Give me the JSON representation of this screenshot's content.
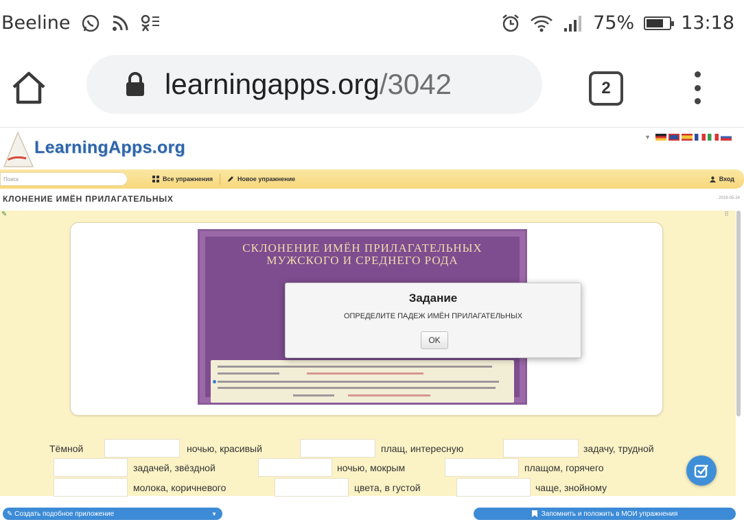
{
  "status_bar": {
    "carrier": "Beeline",
    "battery_percent_text": "75%",
    "battery_level": 0.75,
    "time": "13:18"
  },
  "browser": {
    "url_host": "learningapps.org",
    "url_path": "/3042",
    "tab_count": "2"
  },
  "site": {
    "logo": "LearningApps.org",
    "search_placeholder": "Поиск",
    "nav_all": "Все упражнения",
    "nav_new": "Новое упражнение",
    "nav_login": "Вход",
    "exercise_title": "КЛОНЕНИЕ ИМЁН ПРИЛАГАТЕЛЬНЫХ",
    "exercise_date": "2019-05-24"
  },
  "poster": {
    "title_line1": "СКЛОНЕНИЕ ИМЁН ПРИЛАГАТЕЛЬНЫХ",
    "title_line2": "МУЖСКОГО И СРЕДНЕГО РОДА"
  },
  "dialog": {
    "title": "Задание",
    "text": "ОПРЕДЕЛИТЕ ПАДЕЖ ИМЁН ПРИЛАГАТЕЛЬНЫХ",
    "ok": "OK"
  },
  "exercise": {
    "row1": [
      "Тёмной",
      "ночью, красивый",
      "плащ, интересную",
      "задачу, трудной"
    ],
    "row2": [
      "задачей, звёздной",
      "ночью, мокрым",
      "плащом, горячего"
    ],
    "row3": [
      "молока, коричневого",
      "цвета, в густой",
      "чаще, знойному"
    ]
  },
  "footer": {
    "create": "Создать подобное приложение",
    "save": "Запомнить и положить в МОИ упражнения"
  },
  "colors": {
    "nav_yellow": "#f7d77a",
    "app_background": "#fbf3c6",
    "poster_purple": "#9b68a8",
    "button_blue": "#3d8bd6"
  }
}
